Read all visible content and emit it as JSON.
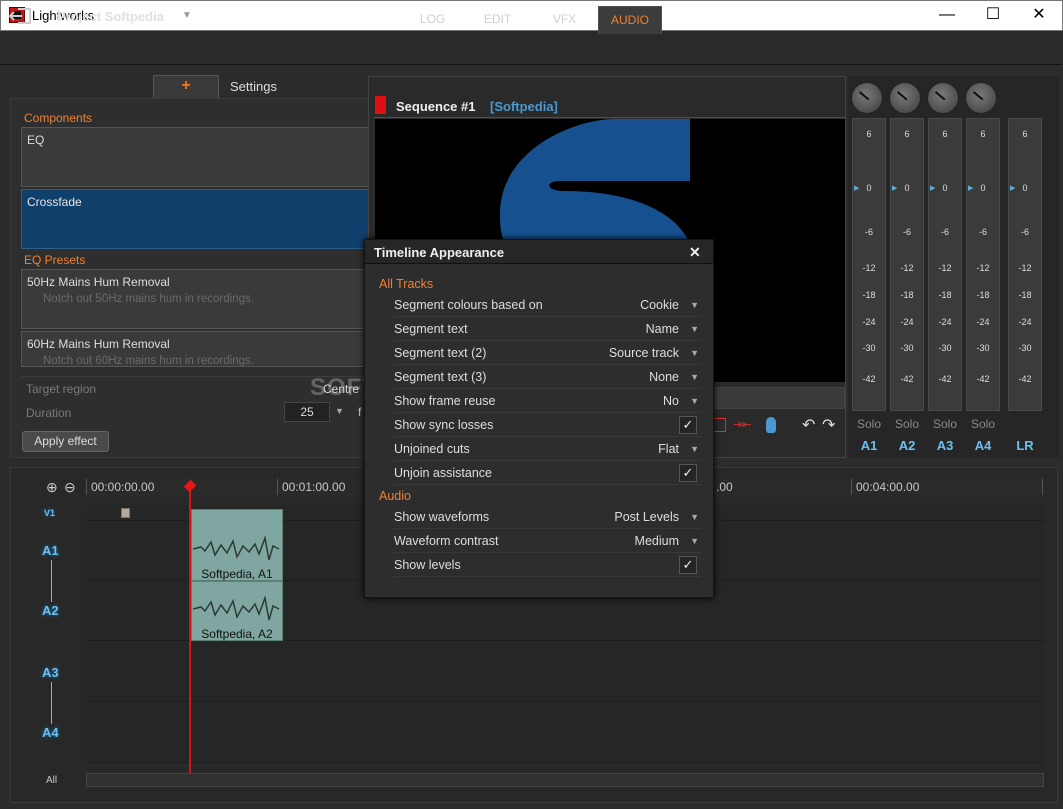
{
  "window": {
    "title": "Lightworks",
    "minimize": "—",
    "maximize": "☐",
    "close": "✕"
  },
  "header": {
    "project": "Project Softpedia",
    "tabs": [
      "LOG",
      "EDIT",
      "VFX",
      "AUDIO"
    ],
    "active_tab": "AUDIO"
  },
  "left_panel": {
    "tab_add": "+",
    "tab_settings": "Settings",
    "components_label": "Components",
    "components": [
      "EQ",
      "Crossfade"
    ],
    "selected_component": "Crossfade",
    "presets_label": "EQ Presets",
    "presets": [
      {
        "name": "50Hz Mains Hum Removal",
        "desc": "Notch out 50Hz mains hum in recordings."
      },
      {
        "name": "60Hz Mains Hum Removal",
        "desc": "Notch out 60Hz mains hum in recordings."
      }
    ],
    "target_region_label": "Target region",
    "target_region_value": "Centre",
    "duration_label": "Duration",
    "duration_value": "25",
    "duration_unit": "f",
    "apply_button": "Apply effect"
  },
  "viewer": {
    "sequence": "Sequence #1",
    "project_tag": "[Softpedia]"
  },
  "mixer": {
    "scale": [
      "6",
      "0",
      "-6",
      "-12",
      "-18",
      "-24",
      "-30",
      "-42"
    ],
    "solo": "Solo",
    "channels": [
      "A1",
      "A2",
      "A3",
      "A4"
    ],
    "master": "LR"
  },
  "timeline": {
    "timecodes": [
      "00:00:00.00",
      "00:01:00.00",
      "00:03:00.00",
      "00:04:00.00"
    ],
    "timecode_partial": ".00",
    "tracks": [
      "V1",
      "A1",
      "A2",
      "A3",
      "A4"
    ],
    "all_label": "All",
    "clips": [
      "Softpedia, A1",
      "Softpedia, A2"
    ]
  },
  "dialog": {
    "title": "Timeline Appearance",
    "close": "✕",
    "sections": [
      {
        "title": "All Tracks",
        "rows": [
          {
            "label": "Segment colours based on",
            "value": "Cookie",
            "type": "dropdown"
          },
          {
            "label": "Segment text",
            "value": "Name",
            "type": "dropdown"
          },
          {
            "label": "Segment text (2)",
            "value": "Source track",
            "type": "dropdown"
          },
          {
            "label": "Segment text (3)",
            "value": "None",
            "type": "dropdown"
          },
          {
            "label": "Show frame reuse",
            "value": "No",
            "type": "dropdown"
          },
          {
            "label": "Show sync losses",
            "value": "✓",
            "type": "check"
          },
          {
            "label": "Unjoined cuts",
            "value": "Flat",
            "type": "dropdown"
          },
          {
            "label": "Unjoin assistance",
            "value": "✓",
            "type": "check"
          }
        ]
      },
      {
        "title": "Audio",
        "rows": [
          {
            "label": "Show waveforms",
            "value": "Post Levels",
            "type": "dropdown"
          },
          {
            "label": "Waveform contrast",
            "value": "Medium",
            "type": "dropdown"
          },
          {
            "label": "Show levels",
            "value": "✓",
            "type": "check"
          }
        ]
      }
    ]
  },
  "watermark": "SOFTPEDIA",
  "colors": {
    "accent": "#f08030",
    "selection": "#113f6c",
    "track_label": "#6cc0f0",
    "playhead": "#d21414",
    "clip": "#7fa6a0"
  }
}
